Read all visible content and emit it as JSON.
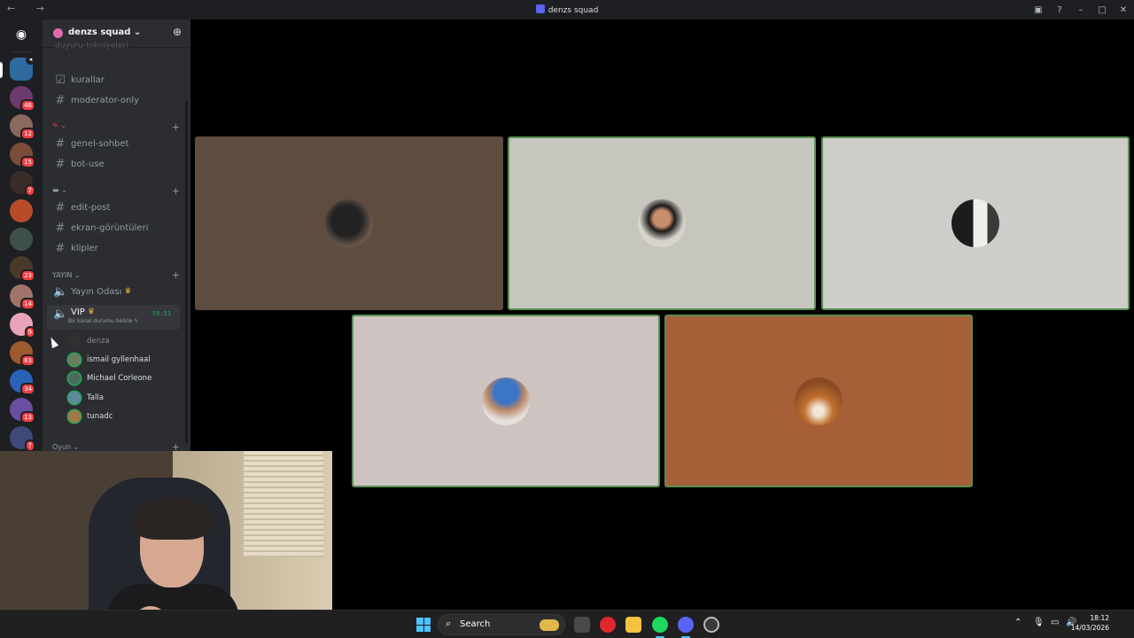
{
  "window": {
    "title": "denzs squad",
    "nav_glyphs": "← →"
  },
  "server": {
    "name": "denzs squad",
    "add_member_icon": "add-member-icon"
  },
  "channels": {
    "partial_top": "duyuru-tokniyeleri",
    "text": [
      {
        "name": "kurallar",
        "icon": "rules-icon"
      },
      {
        "name": "moderator-only",
        "icon": "hash-icon"
      },
      {
        "name": "genel-sohbet",
        "icon": "hash-icon"
      },
      {
        "name": "bot-use",
        "icon": "hash-icon"
      },
      {
        "name": "edit-post",
        "icon": "hash-icon"
      },
      {
        "name": "ekran-görüntüleri",
        "icon": "hash-icon"
      },
      {
        "name": "klipler",
        "icon": "hash-icon"
      }
    ],
    "category_yayin": "YAYIN ⌄",
    "category_oyun": "Oyun ⌄",
    "voice": [
      {
        "name": "Yayın Odası",
        "crown": "♛"
      },
      {
        "name": "VIP",
        "crown": "♛",
        "timer": "59:53",
        "status": "Bir kanal durumu belirle ✎"
      }
    ],
    "voice_users": [
      "denza",
      "ismail gyllenhaal",
      "Michael Corleone",
      "Talla",
      "tunadc"
    ]
  },
  "guild_badges": [
    "46",
    "12",
    "15",
    "7",
    "23",
    "14",
    "9",
    "83",
    "34",
    "13",
    "7"
  ],
  "stage": {
    "tiles": [
      {
        "bg": "#5e4c3f",
        "speaking": false,
        "avatar": "black-cat-avatar"
      },
      {
        "bg": "#c6c6bf",
        "speaking": true,
        "avatar": "curly-hair-avatar"
      },
      {
        "bg": "#cfcdc9",
        "speaking": true,
        "avatar": "wedding-photo-avatar"
      },
      {
        "bg": "#cdc3c1",
        "speaking": true,
        "avatar": "cat-blue-hat-avatar"
      },
      {
        "bg": "#a75f37",
        "speaking": true,
        "avatar": "logo-avatar"
      }
    ]
  },
  "taskbar": {
    "search_label": "Search",
    "time": "18:12",
    "date": "14/03/2026"
  },
  "colors": {
    "accent": "#5865f2",
    "speaking_border": "#5a8f52",
    "voice_green": "#23a559",
    "badge_red": "#f23f43"
  }
}
